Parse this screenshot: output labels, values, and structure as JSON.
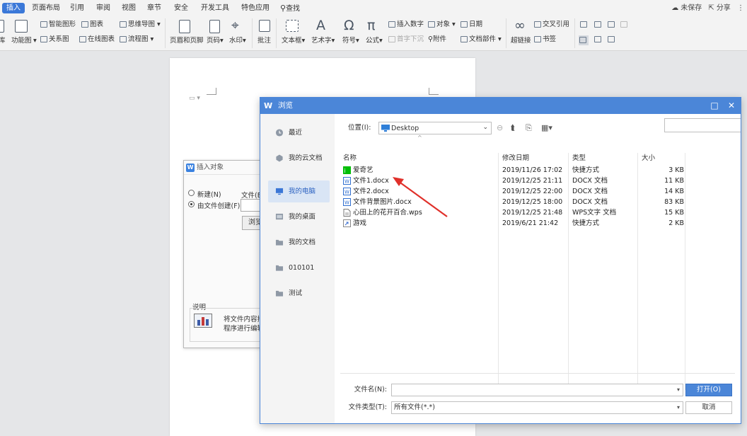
{
  "menubar": {
    "tabs": [
      "插入",
      "页面布局",
      "引用",
      "审阅",
      "视图",
      "章节",
      "安全",
      "开发工具",
      "特色应用",
      "查找"
    ],
    "save_status": "未保存",
    "share": "分享"
  },
  "ribbon": {
    "lib": "库",
    "func_chart": "功能图",
    "smart_shape": "智能图形",
    "chart": "图表",
    "mindmap": "思维导图",
    "relation": "关系图",
    "online_chart": "在线图表",
    "flowchart": "流程图",
    "header_footer": "页眉和页脚",
    "page_num": "页码",
    "watermark": "水印",
    "comment": "批注",
    "textbox": "文本框",
    "art_text": "艺术字",
    "symbol": "符号",
    "formula": "公式",
    "insert_number": "插入数字",
    "object": "对象",
    "date": "日期",
    "drop_cap": "首字下沉",
    "attachment": "附件",
    "doc_parts": "文档部件",
    "hyperlink": "超链接",
    "cross_ref": "交叉引用",
    "bookmark": "书签"
  },
  "insert_dialog": {
    "title": "插入对象",
    "new_option": "新建(N)",
    "from_file_option": "由文件创建(F)",
    "file_label": "文件(E)",
    "browse": "浏览",
    "description_label": "说明",
    "desc_line1": "将文件内容插",
    "desc_line2": "程序进行编辑"
  },
  "browse_dialog": {
    "title": "浏览",
    "sidebar": [
      "最近",
      "我的云文档",
      "我的电脑",
      "我的桌面",
      "我的文档",
      "010101",
      "测试"
    ],
    "location_label": "位置(I):",
    "location_value": "Desktop",
    "columns": {
      "name": "名称",
      "modified": "修改日期",
      "type": "类型",
      "size": "大小"
    },
    "files": [
      {
        "name": "爱奇艺",
        "modified": "2019/11/26 17:02",
        "type": "快捷方式",
        "size": "3 KB",
        "icon": "shortcut-green"
      },
      {
        "name": "文件1.docx",
        "modified": "2019/12/25 21:11",
        "type": "DOCX 文档",
        "size": "11 KB",
        "icon": "docx"
      },
      {
        "name": "文件2.docx",
        "modified": "2019/12/25 22:00",
        "type": "DOCX 文档",
        "size": "14 KB",
        "icon": "docx"
      },
      {
        "name": "文件背景图片.docx",
        "modified": "2019/12/25 18:00",
        "type": "DOCX 文档",
        "size": "83 KB",
        "icon": "docx"
      },
      {
        "name": "心田上的花开百合.wps",
        "modified": "2019/12/25 21:48",
        "type": "WPS文字 文档",
        "size": "15 KB",
        "icon": "wps"
      },
      {
        "name": "游戏",
        "modified": "2019/6/21 21:42",
        "type": "快捷方式",
        "size": "2 KB",
        "icon": "shortcut"
      }
    ],
    "filename_label": "文件名(N):",
    "filename_value": "",
    "filetype_label": "文件类型(T):",
    "filetype_value": "所有文件(*.*)",
    "open_button": "打开(O)",
    "cancel_button": "取消"
  },
  "colors": {
    "accent": "#4b86d8",
    "selected_bg": "#d9e5f5",
    "arrow": "#e0302a"
  }
}
